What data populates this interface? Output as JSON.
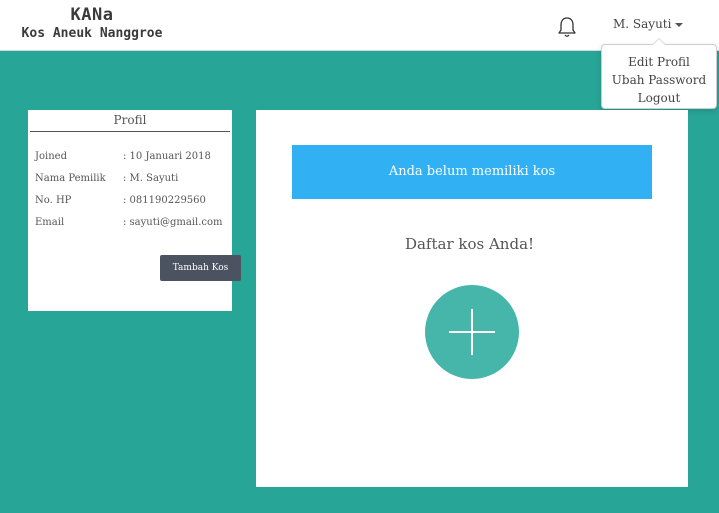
{
  "brand": {
    "name": "KANa",
    "tagline": "Kos Aneuk Nanggroe"
  },
  "user_menu": {
    "name": "M. Sayuti",
    "items": [
      "Edit Profil",
      "Ubah Password",
      "Logout"
    ]
  },
  "profile": {
    "title": "Profil",
    "fields": [
      {
        "label": "Joined",
        "value": ": 10 Januari 2018"
      },
      {
        "label": "Nama Pemilik",
        "value": ": M. Sayuti"
      },
      {
        "label": "No. HP",
        "value": ": 081190229560"
      },
      {
        "label": "Email",
        "value": ": sayuti@gmail.com"
      }
    ],
    "add_button": "Tambah Kos"
  },
  "main": {
    "empty_message": "Anda belum memiliki kos",
    "list_title": "Daftar kos Anda!"
  },
  "icons": {
    "notification": "bell-icon",
    "add": "plus-icon",
    "dropdown": "caret-down-icon"
  },
  "colors": {
    "background": "#27a597",
    "alert": "#31b0f4",
    "add_circle": "#47b6aa",
    "button": "#4b5360"
  }
}
